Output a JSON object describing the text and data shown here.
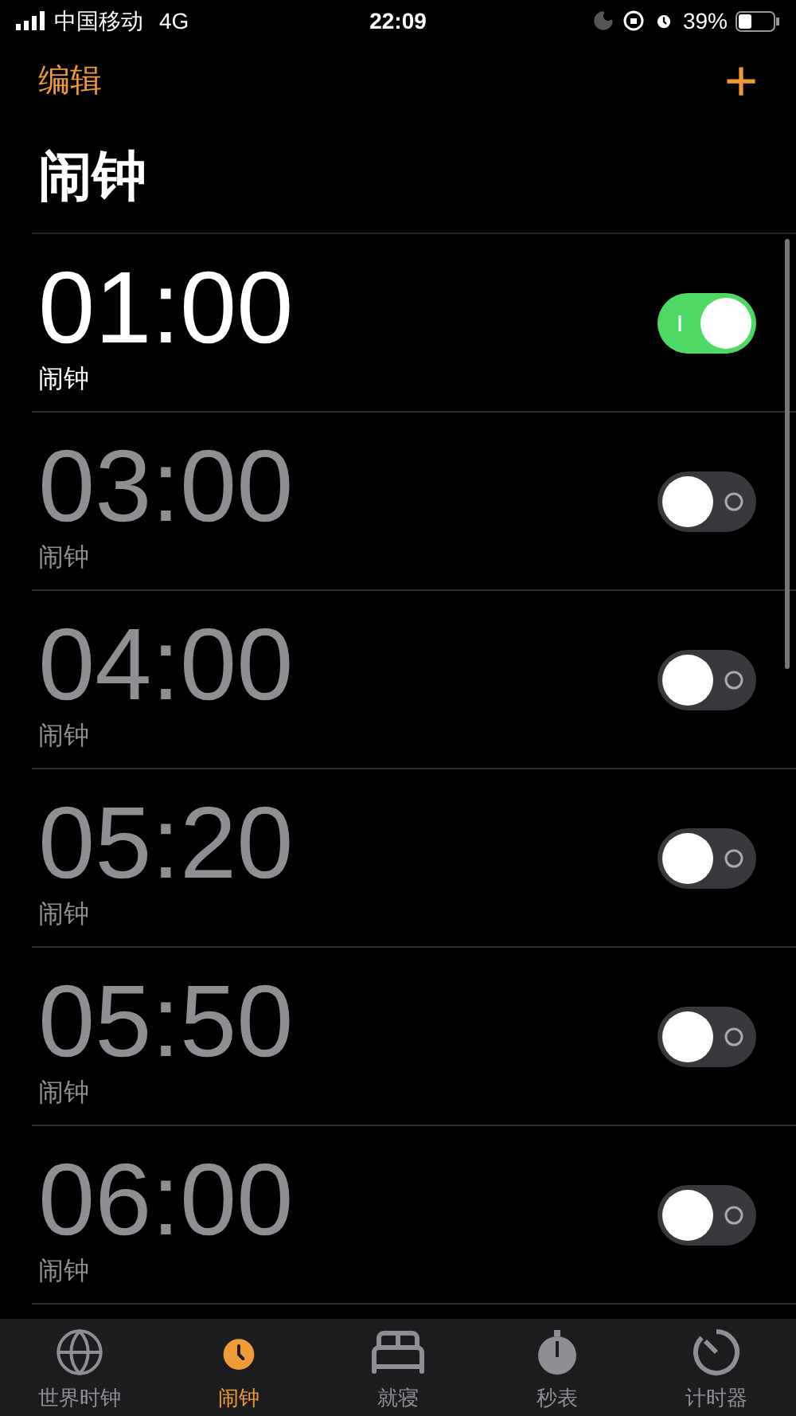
{
  "status_bar": {
    "carrier": "中国移动",
    "network": "4G",
    "time": "22:09",
    "battery": "39%"
  },
  "nav": {
    "edit": "编辑",
    "add": "+"
  },
  "title": "闹钟",
  "alarms": [
    {
      "time": "01:00",
      "label": "闹钟",
      "on": true
    },
    {
      "time": "03:00",
      "label": "闹钟",
      "on": false
    },
    {
      "time": "04:00",
      "label": "闹钟",
      "on": false
    },
    {
      "time": "05:20",
      "label": "闹钟",
      "on": false
    },
    {
      "time": "05:50",
      "label": "闹钟",
      "on": false
    },
    {
      "time": "06:00",
      "label": "闹钟",
      "on": false
    }
  ],
  "tabs": [
    {
      "kind": "globe",
      "label": "世界时钟",
      "selected": false
    },
    {
      "kind": "alarm",
      "label": "闹钟",
      "selected": true
    },
    {
      "kind": "bed",
      "label": "就寝",
      "selected": false
    },
    {
      "kind": "stopwatch",
      "label": "秒表",
      "selected": false
    },
    {
      "kind": "timer",
      "label": "计时器",
      "selected": false
    }
  ]
}
